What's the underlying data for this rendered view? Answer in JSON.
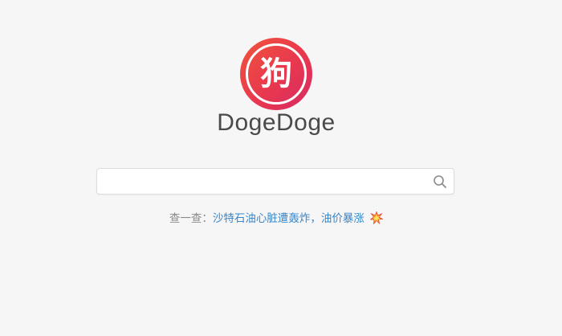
{
  "logo": {
    "glyph": "狗",
    "name": "DogeDoge",
    "gradient_start": "#f0543c",
    "gradient_end": "#d62a63"
  },
  "search": {
    "value": "",
    "placeholder": "",
    "icon": "search-icon"
  },
  "suggestion": {
    "prefix": "查一查：",
    "link_text": "沙特石油心脏遭轰炸，油价暴涨",
    "icon": "collision-icon",
    "link_color": "#3a87c8"
  },
  "colors": {
    "background": "#f7f6f7",
    "brand_text": "#4a4a4a"
  }
}
